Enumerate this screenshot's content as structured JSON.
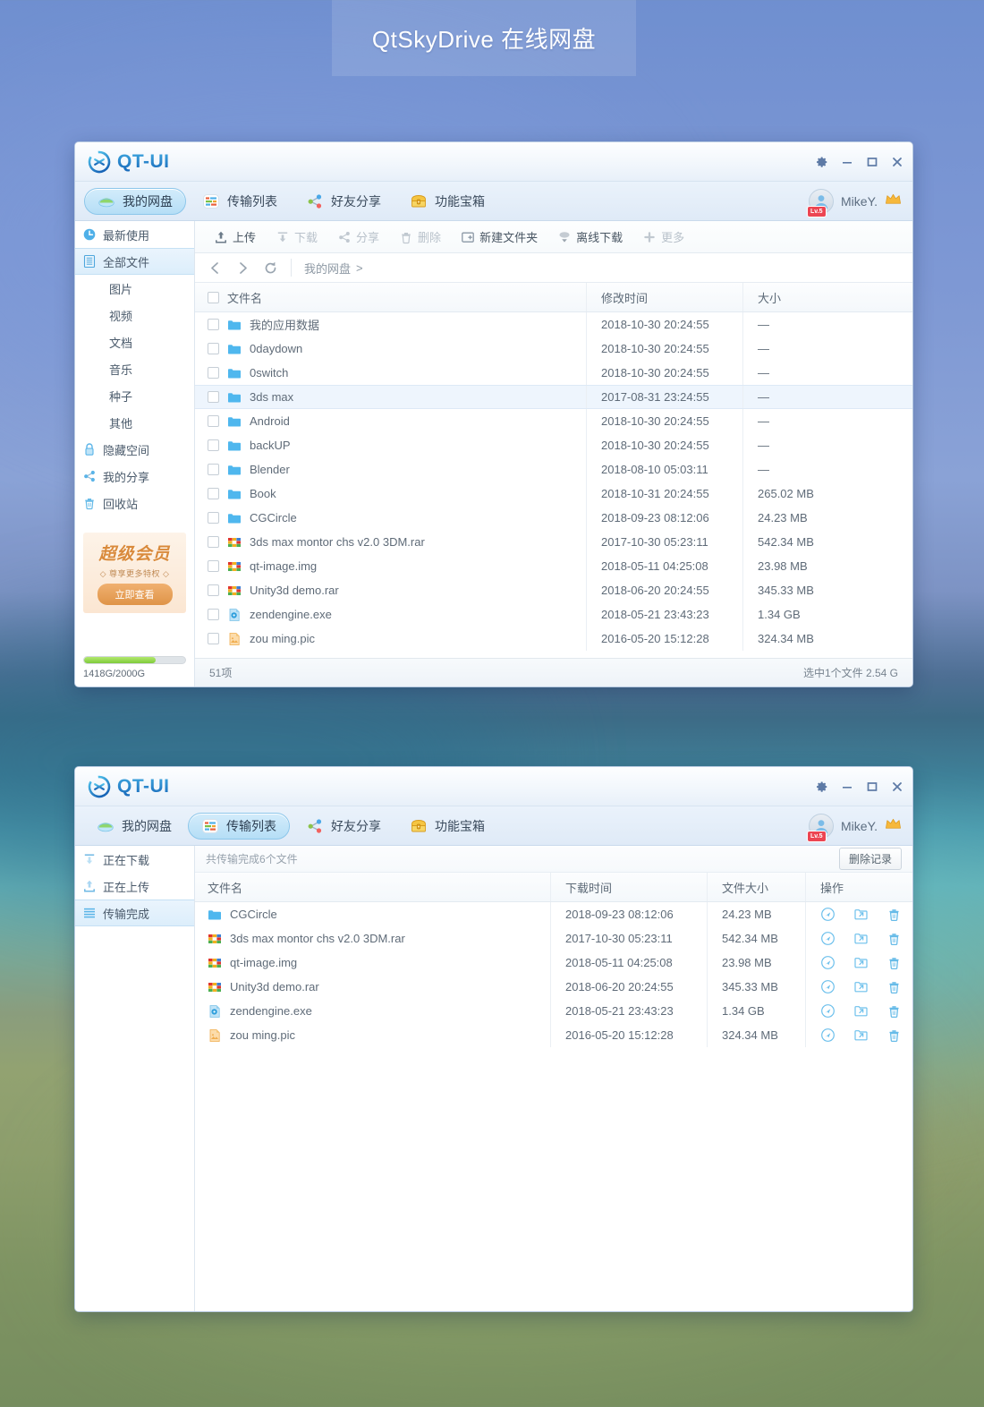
{
  "page": {
    "title": "QtSkyDrive 在线网盘"
  },
  "brand": {
    "name": "QT-UI",
    "logo_icon": "asterisk-circle-icon"
  },
  "window_controls": {
    "settings": "gear-icon",
    "minimize": "minimize-icon",
    "maximize": "maximize-icon",
    "close": "close-icon"
  },
  "nav_tabs": [
    {
      "label": "我的网盘",
      "icon": "cloud-icon",
      "active_main": true,
      "active_transfer": false
    },
    {
      "label": "传输列表",
      "icon": "list-icon",
      "active_main": false,
      "active_transfer": true
    },
    {
      "label": "好友分享",
      "icon": "share-icon",
      "active_main": false,
      "active_transfer": false
    },
    {
      "label": "功能宝箱",
      "icon": "treasure-icon",
      "active_main": false,
      "active_transfer": false
    }
  ],
  "user": {
    "name": "MikeY.",
    "level_badge": "Lv.5",
    "vip_icon": "crown-icon",
    "avatar_icon": "avatar-icon"
  },
  "sidebar_main": {
    "items": [
      {
        "label": "最新使用",
        "icon": "clock-icon",
        "active": false,
        "sub": false
      },
      {
        "label": "全部文件",
        "icon": "files-icon",
        "active": true,
        "sub": false
      },
      {
        "label": "图片",
        "icon": "",
        "active": false,
        "sub": true
      },
      {
        "label": "视频",
        "icon": "",
        "active": false,
        "sub": true
      },
      {
        "label": "文档",
        "icon": "",
        "active": false,
        "sub": true
      },
      {
        "label": "音乐",
        "icon": "",
        "active": false,
        "sub": true
      },
      {
        "label": "种子",
        "icon": "",
        "active": false,
        "sub": true
      },
      {
        "label": "其他",
        "icon": "",
        "active": false,
        "sub": true
      },
      {
        "label": "隐藏空间",
        "icon": "lock-icon",
        "active": false,
        "sub": false
      },
      {
        "label": "我的分享",
        "icon": "share-icon",
        "active": false,
        "sub": false
      },
      {
        "label": "回收站",
        "icon": "trash-icon",
        "active": false,
        "sub": false
      }
    ],
    "promo": {
      "title": "超级会员",
      "subtitle": "◇ 尊享更多特权 ◇",
      "button": "立即查看"
    },
    "quota": {
      "text": "1418G/2000G",
      "percent": 71,
      "fill_color": "#7ecb3a"
    }
  },
  "toolbar": {
    "buttons": [
      {
        "label": "上传",
        "icon": "upload-icon",
        "enabled": true
      },
      {
        "label": "下载",
        "icon": "download-icon",
        "enabled": false
      },
      {
        "label": "分享",
        "icon": "share-icon",
        "enabled": false
      },
      {
        "label": "删除",
        "icon": "trash-icon",
        "enabled": false
      },
      {
        "label": "新建文件夹",
        "icon": "new-folder-icon",
        "enabled": true
      },
      {
        "label": "离线下载",
        "icon": "offline-down-icon",
        "enabled": true
      },
      {
        "label": "更多",
        "icon": "plus-icon",
        "enabled": false
      }
    ]
  },
  "breadcrumb": {
    "back": "back-icon",
    "forward": "forward-icon",
    "refresh": "refresh-icon",
    "path": "我的网盘",
    "chevron": ">"
  },
  "file_table": {
    "columns": [
      "文件名",
      "修改时间",
      "大小"
    ],
    "rows": [
      {
        "name": "我的应用数据",
        "icon": "folder-icon",
        "time": "2018-10-30 20:24:55",
        "size": "—",
        "selected": false
      },
      {
        "name": "0daydown",
        "icon": "folder-icon",
        "time": "2018-10-30 20:24:55",
        "size": "—",
        "selected": false
      },
      {
        "name": "0switch",
        "icon": "folder-icon",
        "time": "2018-10-30 20:24:55",
        "size": "—",
        "selected": false
      },
      {
        "name": "3ds max",
        "icon": "folder-icon",
        "time": "2017-08-31 23:24:55",
        "size": "—",
        "selected": true
      },
      {
        "name": "Android",
        "icon": "folder-icon",
        "time": "2018-10-30 20:24:55",
        "size": "—",
        "selected": false
      },
      {
        "name": "backUP",
        "icon": "folder-icon",
        "time": "2018-10-30 20:24:55",
        "size": "—",
        "selected": false
      },
      {
        "name": "Blender",
        "icon": "folder-icon",
        "time": "2018-08-10 05:03:11",
        "size": "—",
        "selected": false
      },
      {
        "name": "Book",
        "icon": "folder-icon",
        "time": "2018-10-31 20:24:55",
        "size": "265.02 MB",
        "selected": false
      },
      {
        "name": "CGCircle",
        "icon": "folder-icon",
        "time": "2018-09-23 08:12:06",
        "size": "24.23 MB",
        "selected": false
      },
      {
        "name": "3ds max montor chs v2.0 3DM.rar",
        "icon": "archive-icon",
        "time": "2017-10-30 05:23:11",
        "size": "542.34 MB",
        "selected": false
      },
      {
        "name": "qt-image.img",
        "icon": "archive-icon",
        "time": "2018-05-11 04:25:08",
        "size": "23.98 MB",
        "selected": false
      },
      {
        "name": "Unity3d demo.rar",
        "icon": "archive-icon",
        "time": "2018-06-20 20:24:55",
        "size": "345.33 MB",
        "selected": false
      },
      {
        "name": "zendengine.exe",
        "icon": "exe-icon",
        "time": "2018-05-21 23:43:23",
        "size": "1.34 GB",
        "selected": false
      },
      {
        "name": "zou ming.pic",
        "icon": "image-icon",
        "time": "2016-05-20 15:12:28",
        "size": "324.34 MB",
        "selected": false
      }
    ]
  },
  "status_bar": {
    "count": "51项",
    "selection": "选中1个文件 2.54 G"
  },
  "sidebar_transfer": {
    "items": [
      {
        "label": "正在下载",
        "icon": "download-icon",
        "active": false
      },
      {
        "label": "正在上传",
        "icon": "upload-icon",
        "active": false
      },
      {
        "label": "传输完成",
        "icon": "list-icon",
        "active": true
      }
    ]
  },
  "transfer_panel": {
    "summary": "共传输完成6个文件",
    "delete_button": "删除记录",
    "columns": [
      "文件名",
      "下载时间",
      "文件大小",
      "操作"
    ],
    "action_icons": [
      "open-link-icon",
      "open-folder-icon",
      "trash-icon"
    ],
    "rows": [
      {
        "name": "CGCircle",
        "icon": "folder-icon",
        "time": "2018-09-23 08:12:06",
        "size": "24.23 MB"
      },
      {
        "name": "3ds max montor chs v2.0 3DM.rar",
        "icon": "archive-icon",
        "time": "2017-10-30 05:23:11",
        "size": "542.34 MB"
      },
      {
        "name": "qt-image.img",
        "icon": "archive-icon",
        "time": "2018-05-11 04:25:08",
        "size": "23.98 MB"
      },
      {
        "name": "Unity3d demo.rar",
        "icon": "archive-icon",
        "time": "2018-06-20 20:24:55",
        "size": "345.33 MB"
      },
      {
        "name": "zendengine.exe",
        "icon": "exe-icon",
        "time": "2018-05-21 23:43:23",
        "size": "1.34 GB"
      },
      {
        "name": "zou ming.pic",
        "icon": "image-icon",
        "time": "2016-05-20 15:12:28",
        "size": "324.34 MB"
      }
    ]
  },
  "colors": {
    "accent": "#2f8fd8",
    "active_tab": "#b5def6",
    "folder": "#4bb4ee",
    "quota_green": "#7ecb3a",
    "promo_orange": "#d98a3c",
    "badge_red": "#ec4552"
  }
}
